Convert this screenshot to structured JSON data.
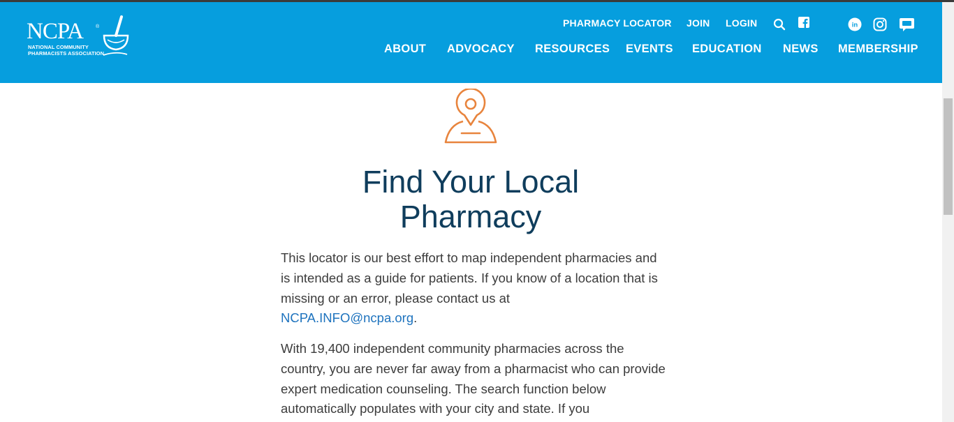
{
  "logo": {
    "wordmark": "NCPA",
    "registered": "®",
    "tagline_line1": "NATIONAL COMMUNITY",
    "tagline_line2": "PHARMACISTS ASSOCIATION"
  },
  "utility_nav": {
    "items": [
      "PHARMACY LOCATOR",
      "JOIN",
      "LOGIN"
    ],
    "icons": [
      "search-icon",
      "facebook-icon",
      "linkedin-icon",
      "instagram-icon",
      "chat-icon"
    ]
  },
  "main_nav": {
    "items": [
      "ABOUT",
      "ADVOCACY",
      "RESOURCES",
      "EVENTS",
      "EDUCATION",
      "NEWS",
      "MEMBERSHIP"
    ]
  },
  "hero": {
    "icon": "location-pin-icon",
    "title_line1": "Find Your Local",
    "title_line2": "Pharmacy"
  },
  "content": {
    "p1_text": "This locator is our best effort to map independent pharmacies and is intended as a guide for patients. If you know of a location that is missing or an error, please contact us at ",
    "p1_email": "NCPA.INFO@ncpa.org",
    "p1_end": ".",
    "p2_text": "With 19,400 independent community pharmacies across the country, you are never far away from a pharmacist who can provide expert medication counseling. The search function below automatically populates with your city and state. If you"
  },
  "colors": {
    "header_bg": "#069ede",
    "title": "#0f3d5c",
    "accent_icon": "#e8843d",
    "link": "#1e73be"
  }
}
